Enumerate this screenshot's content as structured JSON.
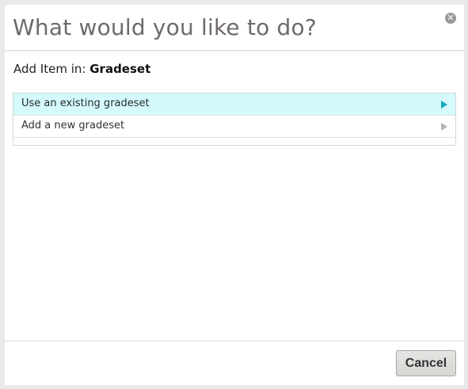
{
  "dialog": {
    "title": "What would you like to do?",
    "close_icon": "close-icon"
  },
  "context": {
    "label": "Add Item in:",
    "value": "Gradeset"
  },
  "options": [
    {
      "label": "Use an existing gradeset",
      "selected": true
    },
    {
      "label": "Add a new gradeset",
      "selected": false
    }
  ],
  "footer": {
    "cancel_label": "Cancel"
  },
  "colors": {
    "selected_row": "#d4fafd",
    "selected_arrow": "#17a7b8"
  }
}
